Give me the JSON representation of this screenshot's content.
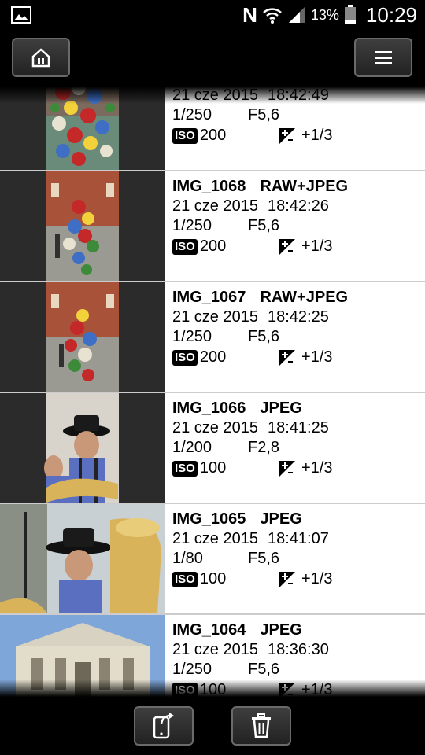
{
  "status_bar": {
    "battery_percent": "13%",
    "time": "10:29",
    "nfc_label": "N",
    "icons": [
      "image-icon",
      "nfc-icon",
      "wifi-icon",
      "signal-icon",
      "battery-icon"
    ]
  },
  "top_bar": {
    "icons": [
      "home-icon",
      "menu-icon"
    ]
  },
  "bottom_bar": {
    "icons": [
      "send-to-phone-icon",
      "trash-icon"
    ]
  },
  "photos": [
    {
      "name": "",
      "format": "",
      "date": "21 cze 2015",
      "time": "18:42:49",
      "shutter": "1/250",
      "aperture": "F5,6",
      "iso_label": "ISO",
      "iso": "200",
      "ev": "+1/3",
      "thumb": "flowers"
    },
    {
      "name": "IMG_1068",
      "format": "RAW+JPEG",
      "date": "21 cze 2015",
      "time": "18:42:26",
      "shutter": "1/250",
      "aperture": "F5,6",
      "iso_label": "ISO",
      "iso": "200",
      "ev": "+1/3",
      "thumb": "flowers-square"
    },
    {
      "name": "IMG_1067",
      "format": "RAW+JPEG",
      "date": "21 cze 2015",
      "time": "18:42:25",
      "shutter": "1/250",
      "aperture": "F5,6",
      "iso_label": "ISO",
      "iso": "200",
      "ev": "+1/3",
      "thumb": "flowers-square"
    },
    {
      "name": "IMG_1066",
      "format": "JPEG",
      "date": "21 cze 2015",
      "time": "18:41:25",
      "shutter": "1/200",
      "aperture": "F2,8",
      "iso_label": "ISO",
      "iso": "100",
      "ev": "+1/3",
      "thumb": "musician-portrait"
    },
    {
      "name": "IMG_1065",
      "format": "JPEG",
      "date": "21 cze 2015",
      "time": "18:41:07",
      "shutter": "1/80",
      "aperture": "F5,6",
      "iso_label": "ISO",
      "iso": "100",
      "ev": "+1/3",
      "thumb": "musician-wide"
    },
    {
      "name": "IMG_1064",
      "format": "JPEG",
      "date": "21 cze 2015",
      "time": "18:36:30",
      "shutter": "1/250",
      "aperture": "F5,6",
      "iso_label": "ISO",
      "iso": "100",
      "ev": "+1/3",
      "thumb": "building"
    }
  ]
}
